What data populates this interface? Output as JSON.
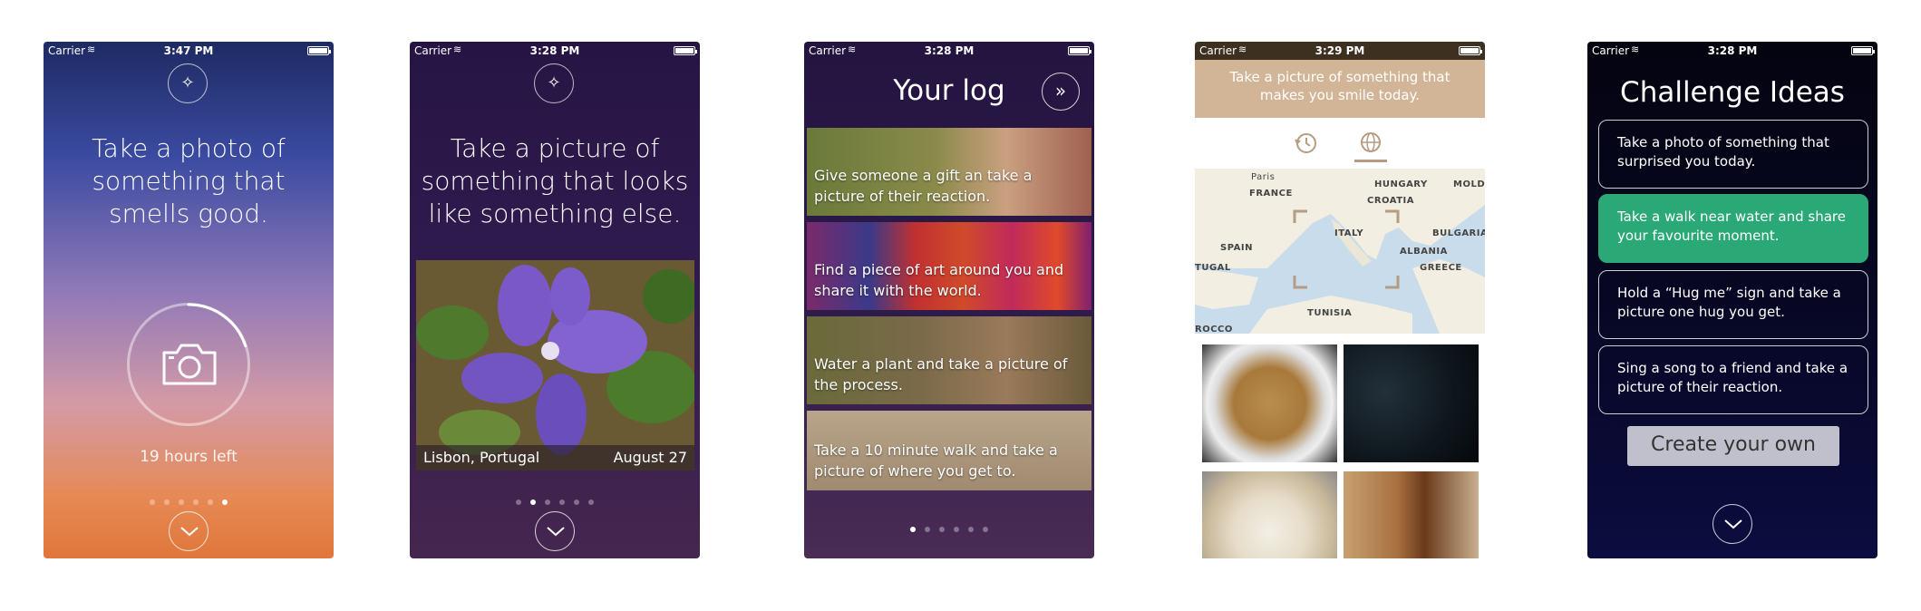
{
  "status": {
    "carrier": "Carrier",
    "times": [
      "3:47 PM",
      "3:28 PM",
      "3:28 PM",
      "3:29 PM",
      "3:28 PM"
    ]
  },
  "screen1": {
    "prompt": "Take a photo of something that smells good.",
    "hours_left": "19 hours left",
    "timer_progress": 0.2,
    "page_index": 5,
    "page_count": 6,
    "gradient_colors": [
      "#1e2a62",
      "#3a4aa0",
      "#8f79b8",
      "#d49aa6",
      "#e68a55",
      "#e0763b"
    ]
  },
  "screen2": {
    "prompt": "Take a picture of something that looks like something else.",
    "photo_location": "Lisbon, Portugal",
    "photo_date": "August 27",
    "page_index": 1,
    "page_count": 6
  },
  "screen3": {
    "title": "Your log",
    "items": [
      {
        "text": "Give someone a gift an take a picture of their reaction."
      },
      {
        "text": "Find a piece of art around you and share it with the world."
      },
      {
        "text": "Water a plant and take a picture of the process."
      },
      {
        "text": "Take a 10 minute walk and take a picture of where you get to."
      }
    ],
    "page_index": 0,
    "page_count": 6
  },
  "screen4": {
    "banner": "Take a picture of something that makes you smile today.",
    "tabs": [
      "history-icon",
      "globe-icon"
    ],
    "active_tab": 1,
    "map_labels": {
      "paris": "Paris",
      "france": "FRANCE",
      "hungary": "HUNGARY",
      "moldova": "MOLDOV",
      "croatia": "CROATIA",
      "italy": "ITALY",
      "spain": "SPAIN",
      "bulgaria": "BULGARIA",
      "albania": "ALBANIA",
      "portugal": "TUGAL",
      "greece": "GREECE",
      "tunisia": "TUNISIA",
      "morocco": "ROCCO"
    },
    "banner_color": "#d2b497"
  },
  "screen5": {
    "title": "Challenge Ideas",
    "ideas": [
      {
        "text": "Take a photo of something that surprised you today."
      },
      {
        "text": "Take a walk near water and share your favourite moment."
      },
      {
        "text": "Hold a “Hug me” sign and take a picture one hug you get."
      },
      {
        "text": "Sing a song to a friend and take a picture of their reaction."
      }
    ],
    "selected_index": 1,
    "create_label": "Create your own",
    "accent": "#2aa876"
  }
}
